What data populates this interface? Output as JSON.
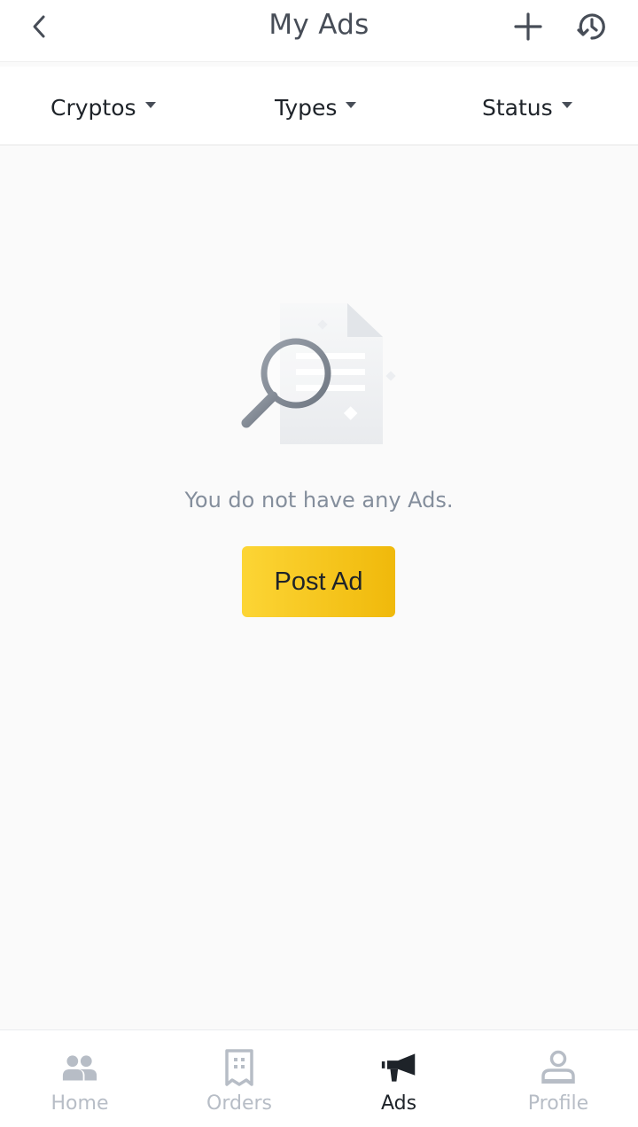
{
  "header": {
    "title": "My Ads",
    "back_icon": "chevron-left-icon",
    "add_icon": "plus-icon",
    "history_icon": "history-icon"
  },
  "filters": [
    {
      "label": "Cryptos"
    },
    {
      "label": "Types"
    },
    {
      "label": "Status"
    }
  ],
  "empty_state": {
    "illustration_icon": "document-search-icon",
    "message": "You do not have any Ads.",
    "button_label": "Post Ad"
  },
  "bottom_nav": {
    "items": [
      {
        "label": "Home",
        "icon": "users-icon",
        "active": false
      },
      {
        "label": "Orders",
        "icon": "receipt-icon",
        "active": false
      },
      {
        "label": "Ads",
        "icon": "megaphone-icon",
        "active": true
      },
      {
        "label": "Profile",
        "icon": "profile-icon",
        "active": false
      }
    ]
  },
  "colors": {
    "accent_start": "#fcd535",
    "accent_end": "#f0b90b",
    "text_primary": "#1e2329",
    "text_secondary": "#848e9c",
    "nav_inactive": "#b7bdc6"
  }
}
